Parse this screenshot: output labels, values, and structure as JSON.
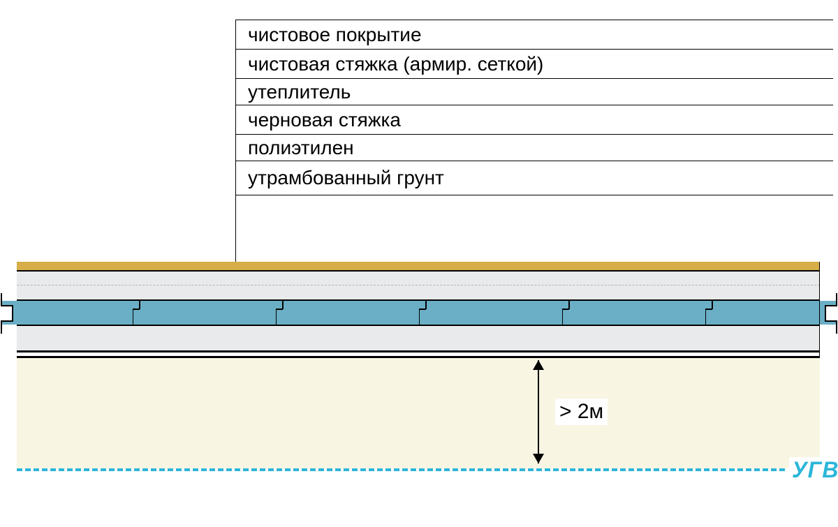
{
  "legend": {
    "items": [
      {
        "label": "чистовое покрытие"
      },
      {
        "label": "чистовая стяжка (армир. сеткой)"
      },
      {
        "label": "утеплитель"
      },
      {
        "label": "черновая стяжка"
      },
      {
        "label": "полиэтилен"
      },
      {
        "label": "утрамбованный грунт"
      }
    ]
  },
  "dimension": {
    "label": "> 2м"
  },
  "groundwater": {
    "label": "УГВ"
  },
  "colors": {
    "finish": "#d6ad47",
    "screed": "#e9eaec",
    "insulation": "#6aafc6",
    "ground": "#f8f5e2",
    "water": "#2bb6d9"
  }
}
